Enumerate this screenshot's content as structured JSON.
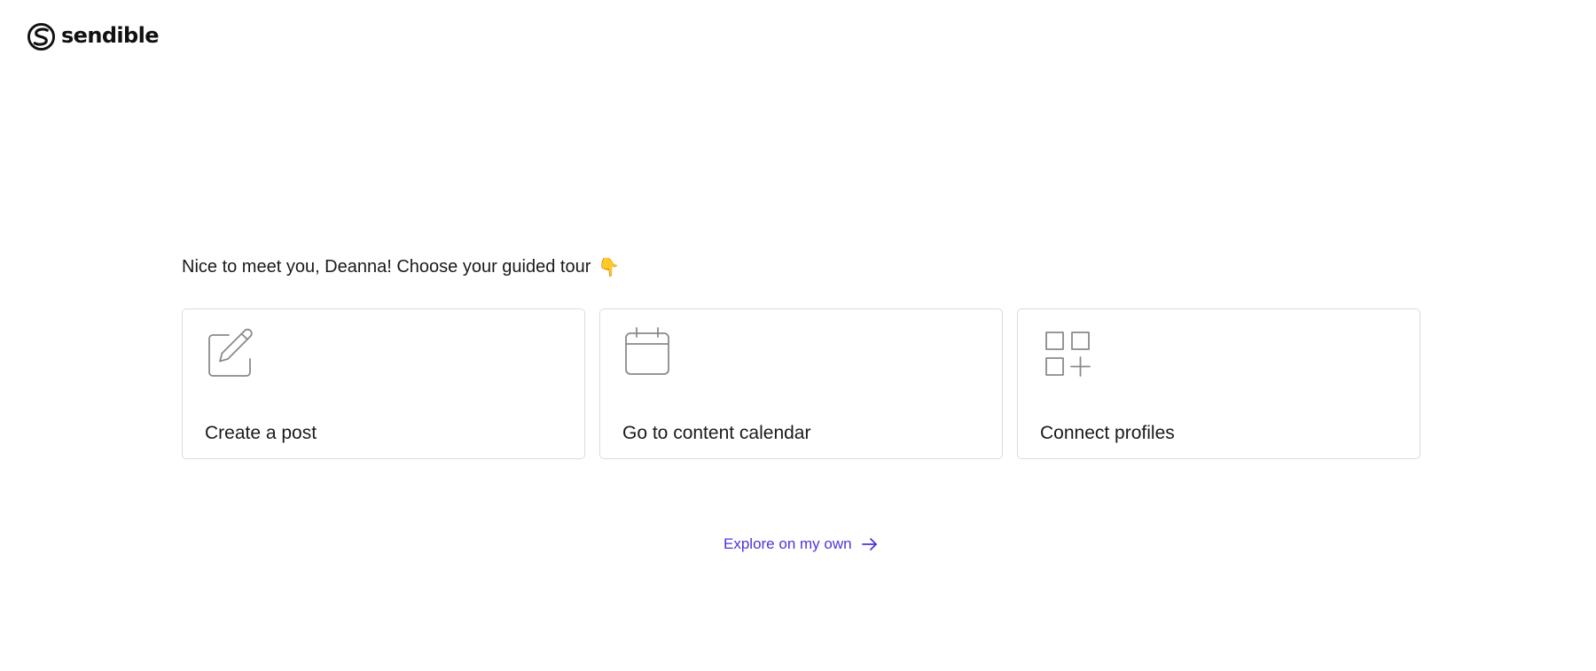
{
  "brand": {
    "name": "sendible",
    "logo_icon": "sendible-logo-icon"
  },
  "main": {
    "heading": "Nice to meet you, Deanna! Choose your guided tour",
    "heading_emoji": "👇",
    "cards": [
      {
        "label": "Create a post",
        "icon": "edit-icon"
      },
      {
        "label": "Go to content calendar",
        "icon": "calendar-icon"
      },
      {
        "label": "Connect profiles",
        "icon": "apps-add-icon"
      }
    ],
    "explore_link": {
      "label": "Explore on my own",
      "icon": "arrow-right-icon"
    }
  },
  "colors": {
    "text": "#1a1a1a",
    "card_border": "#dcdcdc",
    "icon_stroke": "#8a8a8a",
    "link": "#4a36d8"
  }
}
